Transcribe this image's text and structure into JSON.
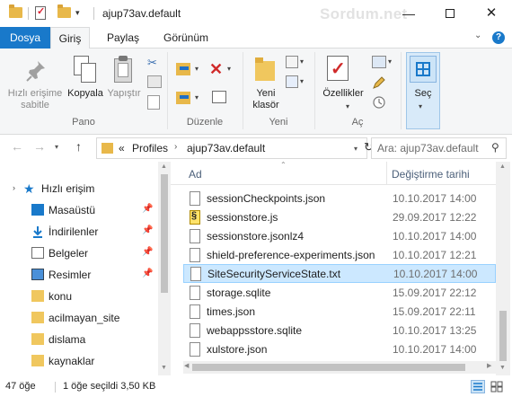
{
  "titlebar": {
    "title": "ajup73av.default",
    "watermark": "Sordum.net",
    "minimize": "—",
    "close": "✕"
  },
  "tabs": {
    "file": "Dosya",
    "home": "Giriş",
    "share": "Paylaş",
    "view": "Görünüm"
  },
  "ribbon": {
    "pin_label_1": "Hızlı erişime",
    "pin_label_2": "sabitle",
    "copy_label": "Kopyala",
    "paste_label": "Yapıştır",
    "group_clipboard": "Pano",
    "group_organize": "Düzenle",
    "new_folder_label_1": "Yeni",
    "new_folder_label_2": "klasör",
    "group_new": "Yeni",
    "properties_label": "Özellikler",
    "group_open": "Aç",
    "select_label": "Seç"
  },
  "address": {
    "overflow": "«",
    "crumb_1": "Profiles",
    "separator": "›",
    "crumb_2": "ajup73av.default",
    "search_placeholder": "Ara: ajup73av.default"
  },
  "nav_pane": {
    "quick_access": "Hızlı erişim",
    "items": [
      {
        "label": "Masaüstü",
        "pinned": true
      },
      {
        "label": "İndirilenler",
        "pinned": true
      },
      {
        "label": "Belgeler",
        "pinned": true
      },
      {
        "label": "Resimler",
        "pinned": true
      },
      {
        "label": "konu",
        "pinned": false
      },
      {
        "label": "acilmayan_site",
        "pinned": false
      },
      {
        "label": "dislama",
        "pinned": false
      },
      {
        "label": "kaynaklar",
        "pinned": false
      }
    ]
  },
  "file_list": {
    "col_name": "Ad",
    "col_date": "Değiştirme tarihi",
    "rows": [
      {
        "name": "sessionCheckpoints.json",
        "date": "10.10.2017 14:00"
      },
      {
        "name": "sessionstore.js",
        "date": "29.09.2017 12:22"
      },
      {
        "name": "sessionstore.jsonlz4",
        "date": "10.10.2017 14:00"
      },
      {
        "name": "shield-preference-experiments.json",
        "date": "10.10.2017 12:21"
      },
      {
        "name": "SiteSecurityServiceState.txt",
        "date": "10.10.2017 14:00"
      },
      {
        "name": "storage.sqlite",
        "date": "15.09.2017 22:12"
      },
      {
        "name": "times.json",
        "date": "15.09.2017 22:11"
      },
      {
        "name": "webappsstore.sqlite",
        "date": "10.10.2017 13:25"
      },
      {
        "name": "xulstore.json",
        "date": "10.10.2017 14:00"
      }
    ]
  },
  "status": {
    "item_count": "47 öğe",
    "selection": "1 öğe seçildi  3,50 KB"
  }
}
